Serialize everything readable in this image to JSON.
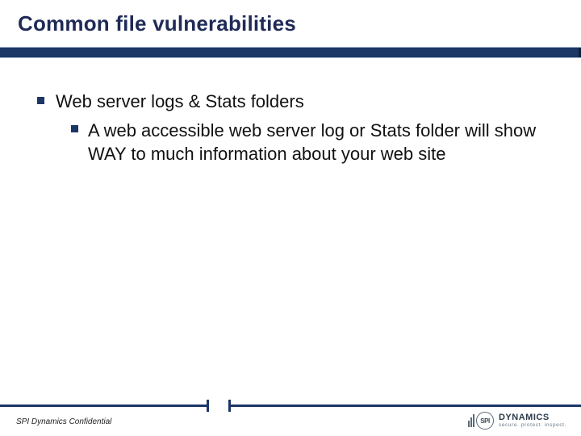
{
  "slide": {
    "title": "Common file vulnerabilities",
    "bullets": [
      {
        "text": "Web server logs & Stats folders",
        "children": [
          {
            "text": "A web accessible web server log or Stats folder will show WAY to much information about your web site"
          }
        ]
      }
    ]
  },
  "footer": {
    "confidential": "SPI Dynamics Confidential"
  },
  "logo": {
    "mark_text": "SPI",
    "brand_main": "DYNAMICS",
    "brand_tag": "secure. protect. inspect."
  }
}
